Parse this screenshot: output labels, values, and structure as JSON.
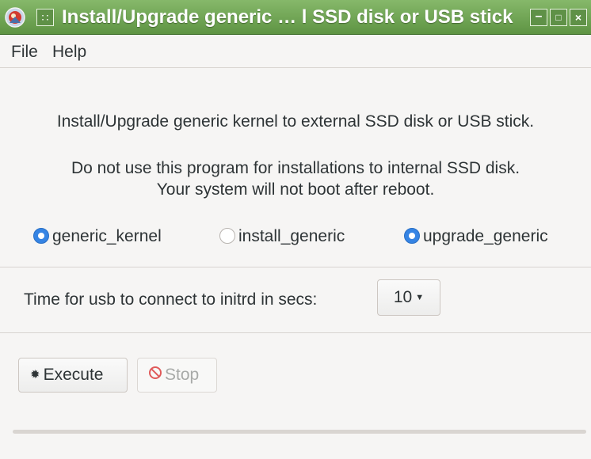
{
  "window": {
    "title": "Install/Upgrade generic … l SSD disk or USB stick",
    "menu_button_glyph": "∷",
    "min_glyph": "–",
    "max_glyph": "□",
    "close_glyph": "×"
  },
  "menu": [
    "File",
    "Help"
  ],
  "content": {
    "line1": "Install/Upgrade generic kernel to external SSD disk or USB stick.",
    "warning1": "Do not use this program for installations to internal SSD disk.",
    "warning2": "Your system will not boot after reboot."
  },
  "radios": [
    {
      "label": "generic_kernel",
      "selected": true
    },
    {
      "label": "install_generic",
      "selected": false
    },
    {
      "label": "upgrade_generic",
      "selected": true
    }
  ],
  "usb_wait": {
    "label": "Time for usb to connect to initrd in secs:",
    "value": "10"
  },
  "buttons": {
    "execute": "Execute",
    "stop": "Stop"
  },
  "progress": {
    "fraction": 0
  },
  "colors": {
    "titlebar": "#6ea553",
    "radio_accent": "#3584e4",
    "stop_icon": "#e05a5a"
  }
}
